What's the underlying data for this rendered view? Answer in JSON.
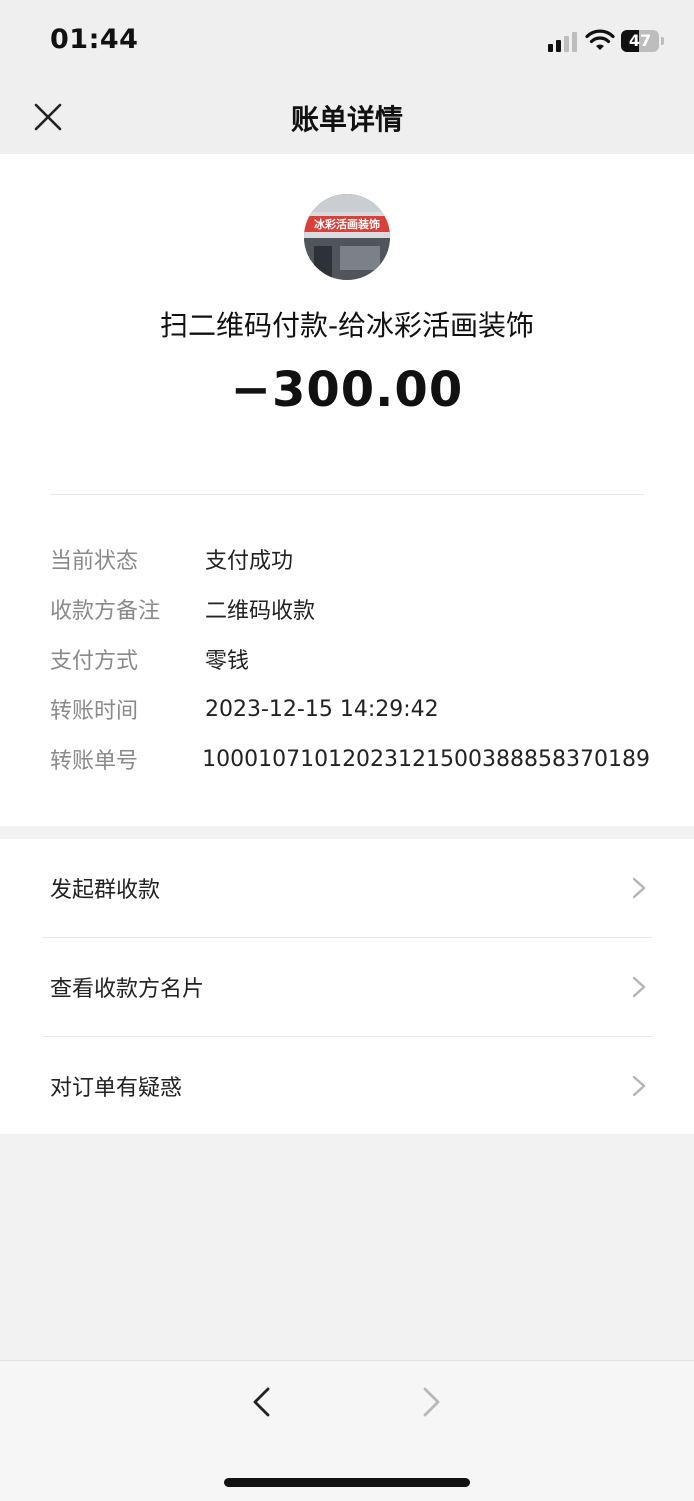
{
  "status_bar": {
    "time": "01:44",
    "battery": "47"
  },
  "nav": {
    "title": "账单详情"
  },
  "transaction": {
    "merchant": "扫二维码付款-给冰彩活画装饰",
    "amount": "−300.00",
    "avatar_sign_text": "冰彩活画装饰"
  },
  "details": [
    {
      "label": "当前状态",
      "value": "支付成功"
    },
    {
      "label": "收款方备注",
      "value": "二维码收款"
    },
    {
      "label": "支付方式",
      "value": "零钱"
    },
    {
      "label": "转账时间",
      "value": "2023-12-15 14:29:42"
    },
    {
      "label": "转账单号",
      "value": "10001071012023121500388858370189"
    }
  ],
  "actions": [
    {
      "label": "发起群收款"
    },
    {
      "label": "查看收款方名片"
    },
    {
      "label": "对订单有疑惑"
    }
  ],
  "icons": [
    "close-icon",
    "signal-icon",
    "wifi-icon",
    "battery-icon",
    "chevron-right-icon",
    "back-arrow-icon",
    "forward-arrow-icon"
  ],
  "colors": {
    "label_gray": "#8a8a8a",
    "background": "#f2f2f2",
    "card": "#ffffff"
  }
}
